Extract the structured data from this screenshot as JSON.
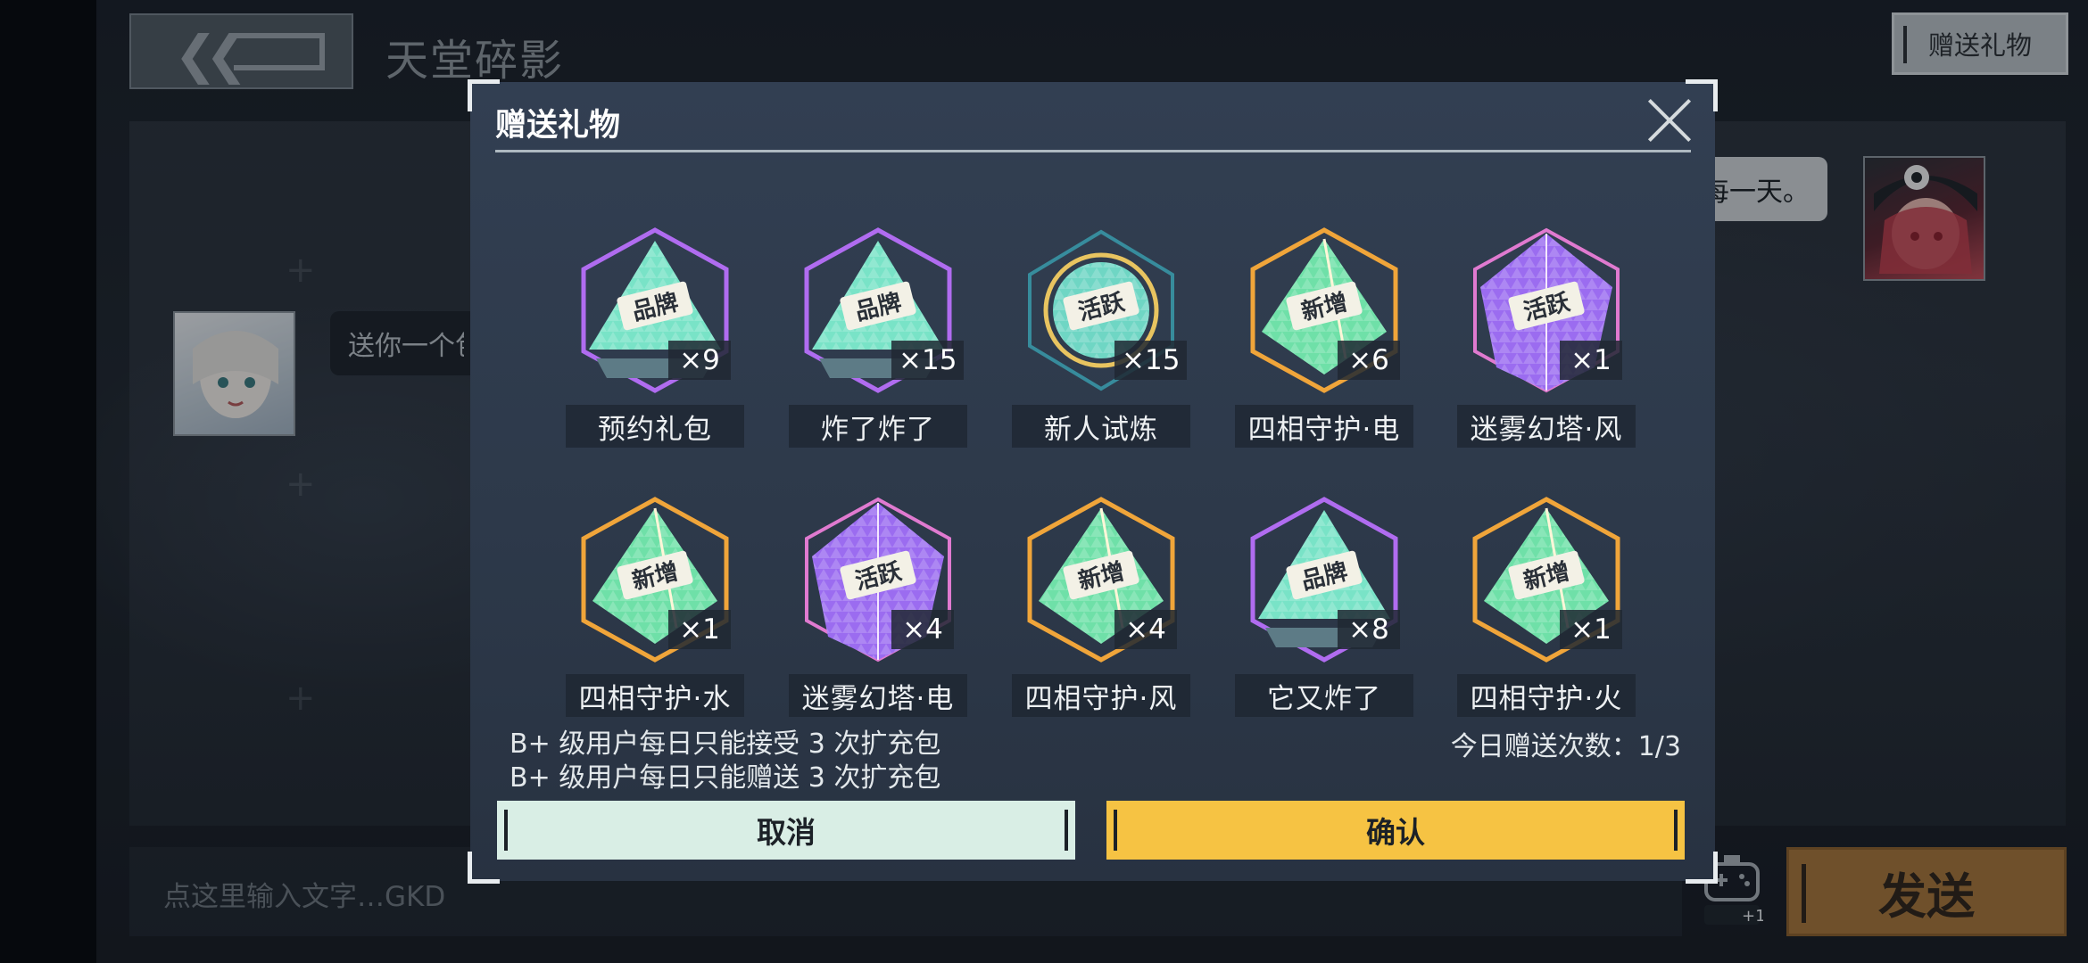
{
  "screen": {
    "page_title": "天堂碎影",
    "gift_top_label": "赠送礼物",
    "bubble_left": "送你一个包",
    "bubble_right": "每一天。",
    "input_placeholder": "点这里输入文字…GKD",
    "send_label": "发送",
    "gamepad_badge": "+1"
  },
  "modal": {
    "title": "赠送礼物",
    "gifts": [
      {
        "name": "预约礼包",
        "count": "×9",
        "type": "brand",
        "badge": "品牌",
        "colors": [
          "#b06cf0",
          "#79e3c7"
        ]
      },
      {
        "name": "炸了炸了",
        "count": "×15",
        "type": "brand",
        "badge": "品牌",
        "colors": [
          "#b06cf0",
          "#79e3c7"
        ]
      },
      {
        "name": "新人试炼",
        "count": "×15",
        "type": "active",
        "badge": "活跃",
        "colors": [
          "#6fd6c4",
          "#3aa0b0"
        ]
      },
      {
        "name": "四相守护·电",
        "count": "×6",
        "type": "new",
        "badge": "新增",
        "colors": [
          "#f0a53a",
          "#6fe0a8"
        ]
      },
      {
        "name": "迷雾幻塔·风",
        "count": "×1",
        "type": "active-crystal",
        "badge": "活跃",
        "colors": [
          "#9b6cf0",
          "#e07ad0"
        ]
      },
      {
        "name": "四相守护·水",
        "count": "×1",
        "type": "new",
        "badge": "新增",
        "colors": [
          "#f0a53a",
          "#6fe0a8"
        ]
      },
      {
        "name": "迷雾幻塔·电",
        "count": "×4",
        "type": "active-crystal",
        "badge": "活跃",
        "colors": [
          "#9b6cf0",
          "#e07ad0"
        ]
      },
      {
        "name": "四相守护·风",
        "count": "×4",
        "type": "new",
        "badge": "新增",
        "colors": [
          "#f0a53a",
          "#6fe0a8"
        ]
      },
      {
        "name": "它又炸了",
        "count": "×8",
        "type": "brand",
        "badge": "品牌",
        "colors": [
          "#b06cf0",
          "#79e3c7"
        ]
      },
      {
        "name": "四相守护·火",
        "count": "×1",
        "type": "new",
        "badge": "新增",
        "colors": [
          "#f0a53a",
          "#6fe0a8"
        ]
      }
    ],
    "notice_1": "B+ 级用户每日只能接受 3 次扩充包",
    "notice_2": "B+ 级用户每日只能赠送 3 次扩充包",
    "daily_count": "今日赠送次数：1/3",
    "cancel_label": "取消",
    "confirm_label": "确认"
  }
}
